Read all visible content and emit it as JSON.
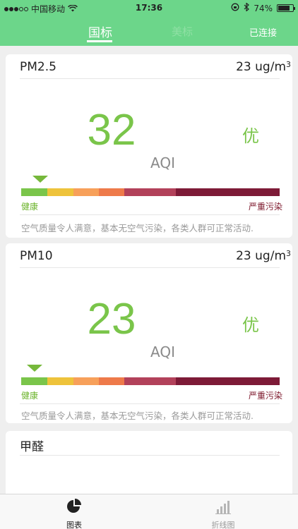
{
  "status_bar": {
    "carrier": "中国移动",
    "time": "17:36",
    "battery": "74%"
  },
  "header": {
    "tab_active": "国标",
    "tab_inactive": "美标",
    "connection": "已连接"
  },
  "cards": [
    {
      "title": "PM2.5",
      "unit": "23 ug/m",
      "unit_sup": "3",
      "value": "32",
      "grade": "优",
      "aqi_label": "AQI",
      "level_label_low": "健康",
      "level_label_high": "严重污染",
      "description": "空气质量令人满意，基本无空气污染，各类人群可正常活动."
    },
    {
      "title": "PM10",
      "unit": "23 ug/m",
      "unit_sup": "3",
      "value": "23",
      "grade": "优",
      "aqi_label": "AQI",
      "level_label_low": "健康",
      "level_label_high": "严重污染",
      "description": "空气质量令人满意，基本无空气污染，各类人群可正常活动."
    },
    {
      "title": "甲醛"
    }
  ],
  "scale_colors": [
    "#7ac54a",
    "#eec33b",
    "#f7a05a",
    "#ee7a4a",
    "#b2415a",
    "#7d1a37"
  ],
  "tabbar": {
    "chart_label": "图表",
    "line_label": "折线图"
  },
  "colors": {
    "header_green": "#6cd68a",
    "value_green": "#7ac54a",
    "severe_red": "#7b1428"
  }
}
